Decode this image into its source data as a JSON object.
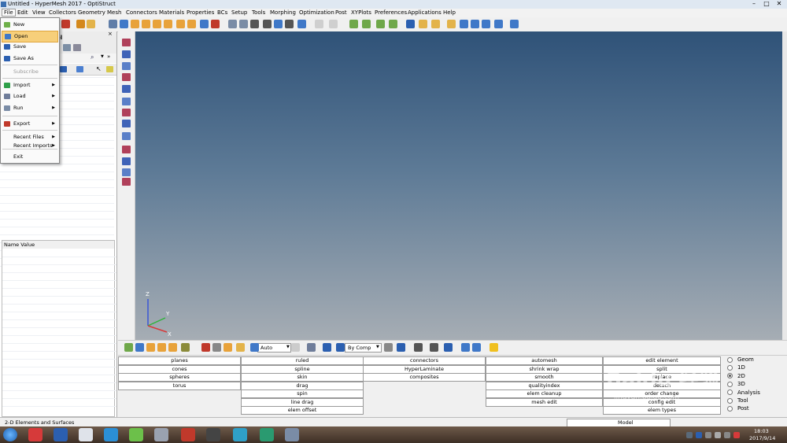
{
  "window": {
    "title": "Untitled - HyperMesh 2017 - OptiStruct",
    "minimize": "–",
    "maximize": "□",
    "close": "✕"
  },
  "menubar": [
    "File",
    "Edit",
    "View",
    "Collectors",
    "Geometry",
    "Mesh",
    "Connectors",
    "Materials",
    "Properties",
    "BCs",
    "Setup",
    "Tools",
    "Morphing",
    "Optimization",
    "Post",
    "XYPlots",
    "Preferences",
    "Applications",
    "Help"
  ],
  "file_menu": {
    "items": [
      {
        "label": "New",
        "icon": "new-file-icon",
        "submenu": false,
        "state": "normal"
      },
      {
        "label": "Open",
        "icon": "open-folder-icon",
        "submenu": false,
        "state": "active"
      },
      {
        "label": "Save",
        "icon": "save-icon",
        "submenu": false,
        "state": "normal"
      },
      {
        "label": "Save As",
        "icon": "save-as-icon",
        "submenu": false,
        "state": "normal"
      },
      {
        "label": "Subscribe",
        "icon": "",
        "submenu": false,
        "state": "disabled"
      },
      {
        "label": "Import",
        "icon": "import-icon",
        "submenu": true,
        "state": "normal"
      },
      {
        "label": "Load",
        "icon": "load-icon",
        "submenu": true,
        "state": "normal"
      },
      {
        "label": "Run",
        "icon": "run-icon",
        "submenu": true,
        "state": "normal"
      },
      {
        "label": "Export",
        "icon": "export-icon",
        "submenu": true,
        "state": "normal"
      },
      {
        "label": "Recent Files",
        "icon": "",
        "submenu": true,
        "state": "normal"
      },
      {
        "label": "Recent Imports",
        "icon": "",
        "submenu": true,
        "state": "normal"
      },
      {
        "label": "Exit",
        "icon": "",
        "submenu": false,
        "state": "normal"
      }
    ]
  },
  "left_panel": {
    "tab_fragment": "el",
    "properties_header": "Name Value",
    "collapse_marker": "▼"
  },
  "toolbar2": {
    "auto_label": "Auto",
    "bycomp_label": "By Comp"
  },
  "panel_buttons": {
    "col1": [
      "planes",
      "cones",
      "spheres",
      "torus"
    ],
    "col2": [
      "ruled",
      "spline",
      "skin",
      "drag",
      "spin",
      "line drag",
      "elem offset"
    ],
    "col3": [
      "connectors",
      "HyperLaminate",
      "composites"
    ],
    "col4": [
      "automesh",
      "shrink wrap",
      "smooth",
      "qualityindex",
      "elem cleanup",
      "mesh edit"
    ],
    "col5": [
      "edit element",
      "split",
      "replace",
      "detach",
      "order change",
      "config edit",
      "elem types"
    ]
  },
  "radio_group": [
    {
      "label": "Geom",
      "selected": false
    },
    {
      "label": "1D",
      "selected": false
    },
    {
      "label": "2D",
      "selected": true
    },
    {
      "label": "3D",
      "selected": false
    },
    {
      "label": "Analysis",
      "selected": false
    },
    {
      "label": "Tool",
      "selected": false
    },
    {
      "label": "Post",
      "selected": false
    }
  ],
  "statusbar": {
    "text": "2-D Elements and Surfaces",
    "model_label": "Model"
  },
  "triad": {
    "z": "Z",
    "y": "Y",
    "x": "X"
  },
  "taskbar": {
    "time": "18:03",
    "date": "2017/9/14"
  },
  "watermark": "Baidu 经验",
  "watermark_sub": "jingyan.baidu.com",
  "colors": {
    "viewport_top": "#2f5278",
    "viewport_bottom": "#a6adb4",
    "menu_highlight": "#f7cf7a"
  }
}
